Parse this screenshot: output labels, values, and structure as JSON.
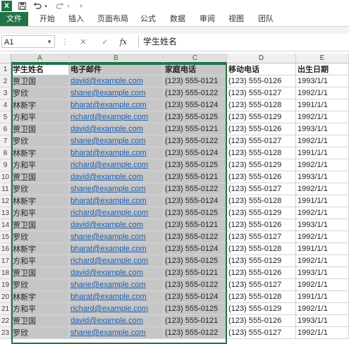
{
  "title_bar": {
    "app_icon_label": "X",
    "save_icon": "save-icon",
    "undo_icon": "undo-icon",
    "redo_icon": "redo-icon"
  },
  "ribbon": {
    "tabs": [
      "文件",
      "开始",
      "插入",
      "页面布局",
      "公式",
      "数据",
      "审阅",
      "视图",
      "团队"
    ]
  },
  "formula_bar": {
    "name_box": "A1",
    "fx_label": "fx",
    "value": "学生姓名"
  },
  "columns": [
    "A",
    "B",
    "C",
    "D",
    "E"
  ],
  "header_row": [
    "学生姓名",
    "电子邮件",
    "家庭电话",
    "移动电话",
    "出生日期"
  ],
  "rows": [
    [
      "贾卫国",
      "david@example.com",
      "(123) 555-0121",
      "(123) 555-0126",
      "1993/1/1"
    ],
    [
      "罗欣",
      "shane@example.com",
      "(123) 555-0122",
      "(123) 555-0127",
      "1992/1/1"
    ],
    [
      "林新宇",
      "bharat@example.com",
      "(123) 555-0124",
      "(123) 555-0128",
      "1991/1/1"
    ],
    [
      "方和平",
      "richard@example.com",
      "(123) 555-0125",
      "(123) 555-0129",
      "1992/1/1"
    ],
    [
      "贾卫国",
      "david@example.com",
      "(123) 555-0121",
      "(123) 555-0126",
      "1993/1/1"
    ],
    [
      "罗欣",
      "shane@example.com",
      "(123) 555-0122",
      "(123) 555-0127",
      "1992/1/1"
    ],
    [
      "林新宇",
      "bharat@example.com",
      "(123) 555-0124",
      "(123) 555-0128",
      "1991/1/1"
    ],
    [
      "方和平",
      "richard@example.com",
      "(123) 555-0125",
      "(123) 555-0129",
      "1992/1/1"
    ],
    [
      "贾卫国",
      "david@example.com",
      "(123) 555-0121",
      "(123) 555-0126",
      "1993/1/1"
    ],
    [
      "罗欣",
      "shane@example.com",
      "(123) 555-0122",
      "(123) 555-0127",
      "1992/1/1"
    ],
    [
      "林新宇",
      "bharat@example.com",
      "(123) 555-0124",
      "(123) 555-0128",
      "1991/1/1"
    ],
    [
      "方和平",
      "richard@example.com",
      "(123) 555-0125",
      "(123) 555-0129",
      "1992/1/1"
    ],
    [
      "贾卫国",
      "david@example.com",
      "(123) 555-0121",
      "(123) 555-0126",
      "1993/1/1"
    ],
    [
      "罗欣",
      "shane@example.com",
      "(123) 555-0122",
      "(123) 555-0127",
      "1992/1/1"
    ],
    [
      "林新宇",
      "bharat@example.com",
      "(123) 555-0124",
      "(123) 555-0128",
      "1991/1/1"
    ],
    [
      "方和平",
      "richard@example.com",
      "(123) 555-0125",
      "(123) 555-0129",
      "1992/1/1"
    ],
    [
      "贾卫国",
      "david@example.com",
      "(123) 555-0121",
      "(123) 555-0126",
      "1993/1/1"
    ],
    [
      "罗欣",
      "shane@example.com",
      "(123) 555-0122",
      "(123) 555-0127",
      "1992/1/1"
    ],
    [
      "林新宇",
      "bharat@example.com",
      "(123) 555-0124",
      "(123) 555-0128",
      "1991/1/1"
    ],
    [
      "方和平",
      "richard@example.com",
      "(123) 555-0125",
      "(123) 555-0129",
      "1992/1/1"
    ],
    [
      "贾卫国",
      "david@example.com",
      "(123) 555-0121",
      "(123) 555-0126",
      "1993/1/1"
    ],
    [
      "罗欣",
      "shane@example.com",
      "(123) 555-0122",
      "(123) 555-0127",
      "1992/1/1"
    ]
  ],
  "colors": {
    "accent": "#217346",
    "selection": "#c6c6c6",
    "link": "#1a5fb4"
  }
}
